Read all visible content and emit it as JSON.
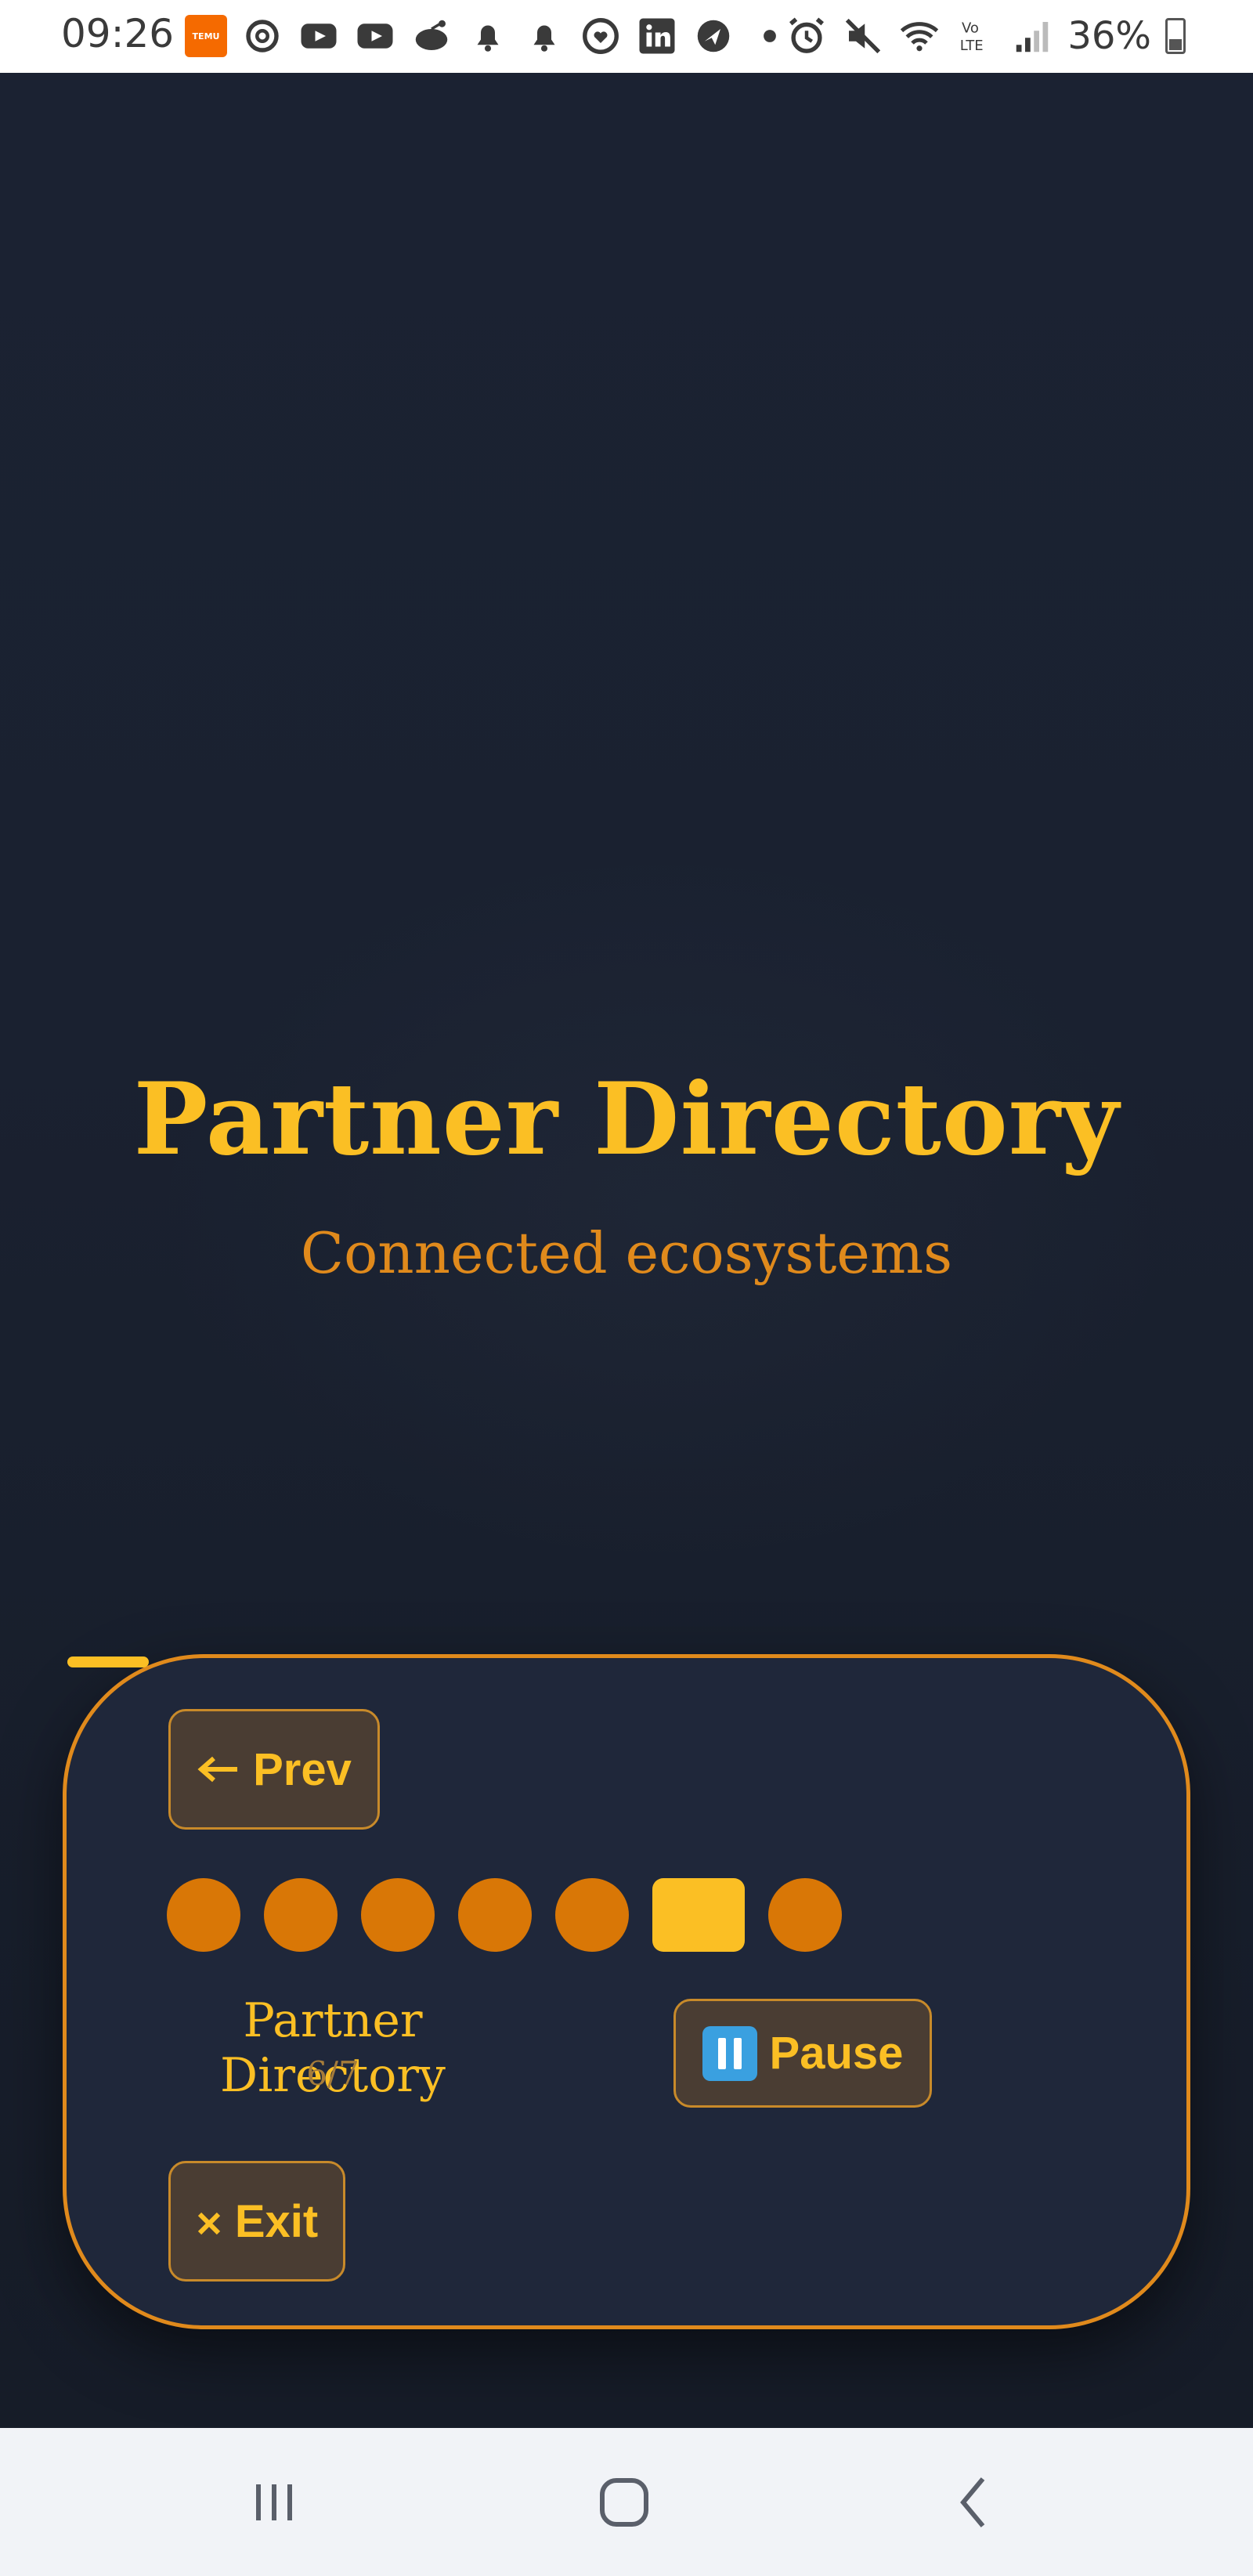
{
  "status_bar": {
    "time": "09:26",
    "temu_label": "TEMU",
    "battery": "36%",
    "left_icons": [
      "temu-icon",
      "threads-icon",
      "youtube-icon",
      "youtube-icon",
      "reddit-icon",
      "bell-icon",
      "bell-icon",
      "heart-circle-icon",
      "linkedin-icon",
      "navigation-icon",
      "dot-icon"
    ],
    "right_icons": [
      "alarm-icon",
      "mute-icon",
      "wifi-icon",
      "volte-icon",
      "signal-icon",
      "battery-icon"
    ]
  },
  "slide": {
    "title": "Partner Directory",
    "subtitle": "Connected ecosystems"
  },
  "controls": {
    "prev_label": "Prev",
    "pause_label": "Pause",
    "exit_label": "Exit",
    "current_label": "Partner Directory",
    "counter": "6/7",
    "total_slides": 7,
    "active_index": 6
  },
  "colors": {
    "accent": "#fbbf24",
    "accent_dark": "#d97706",
    "panel_border": "#e08a1c",
    "panel_bg": "#1f273a",
    "background": "#1a2130"
  }
}
